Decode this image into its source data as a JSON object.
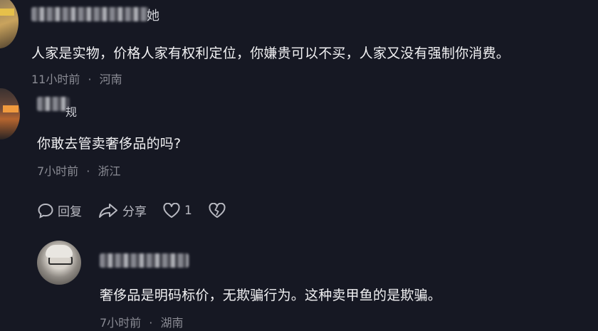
{
  "comments": [
    {
      "username_suffix": "她",
      "text": "人家是实物，价格人家有权利定位，你嫌贵可以不买，人家又没有强制你消费。",
      "time": "11小时前",
      "location": "河南"
    },
    {
      "username_suffix": "",
      "text": "你敢去管卖奢侈品的吗?",
      "time": "7小时前",
      "location": "浙江",
      "reply_label": "回复",
      "share_label": "分享",
      "like_count": "1"
    },
    {
      "username_suffix": "",
      "text": "奢侈品是明码标价，无欺骗行为。这种卖甲鱼的是欺骗。",
      "time": "7小时前",
      "location": "湖南"
    }
  ],
  "separator": "·",
  "colors": {
    "background": "#161823",
    "text": "#f1f1f3",
    "meta": "#8a8b94"
  }
}
